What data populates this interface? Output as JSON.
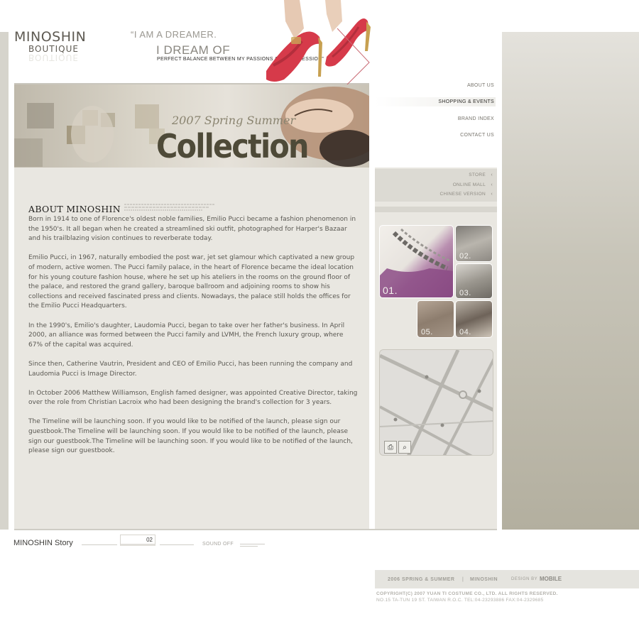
{
  "brand": {
    "logo_main": "MINOSHIN",
    "logo_sub": "BOUTIQUE"
  },
  "tagline": {
    "line1": "“I AM A DREAMER.",
    "line2": "I DREAM OF",
    "line3": "PERFECT BALANCE BETWEEN MY PASSIONS AND PROFESSION”"
  },
  "banner": {
    "season": "2007 Spring Summer",
    "title": "Collection"
  },
  "nav": {
    "items": [
      {
        "label": "ABOUT US"
      },
      {
        "label": "SHOPPING & EVENTS"
      },
      {
        "label": "BRAND INDEX"
      },
      {
        "label": "CONTACT US"
      }
    ],
    "active": "SHOPPING & EVENTS"
  },
  "subnav": {
    "items": [
      {
        "label": "STORE"
      },
      {
        "label": "ONLINE MALL"
      },
      {
        "label": "CHINESE VERSION"
      }
    ]
  },
  "article": {
    "heading": "ABOUT MINOSHIN",
    "paragraphs": [
      "Born in 1914 to one of Florence's oldest noble families, Emilio Pucci became a fashion phenomenon in the 1950's. It all began when he created a streamlined ski outfit, photographed for Harper's Bazaar and his trailblazing vision continues to reverberate today.",
      "Emilio Pucci, in 1967, naturally embodied the post war, jet set glamour which captivated a new group of modern, active women. The Pucci family palace, in the heart of Florence became the ideal location for his young couture fashion house, where he set up his ateliers in the rooms on the ground floor of the palace, and restored the grand gallery, baroque ballroom and adjoining rooms to show his collections and received fascinated press and clients. Nowadays, the palace still holds the offices for the Emilio Pucci Headquarters.",
      "In the 1990's, Emilio's daughter, Laudomia Pucci, began to take over her father's business. In April 2000, an alliance was formed between the Pucci family and LVMH, the French luxury group, where 67% of the capital was acquired.",
      "Since then, Catherine Vautrin, President and CEO of Emilio Pucci, has been running the company and Laudomia Pucci is Image Director.",
      "In October 2006 Matthew Williamson, English famed designer, was appointed Creative Director, taking over the role from Christian Lacroix who had been designing the brand's collection for 3 years.",
      "The Timeline will be launching soon. If you would like to be notified of the launch, please sign our guestbook.The Timeline will be launching soon. If you would like to be notified of the launch, please sign our guestbook.The Timeline will be launching soon. If you would like to be notified of the launch, please sign our guestbook."
    ]
  },
  "gallery": {
    "thumbs": [
      {
        "num": "01."
      },
      {
        "num": "02."
      },
      {
        "num": "03."
      },
      {
        "num": "04."
      },
      {
        "num": "05."
      }
    ]
  },
  "map": {
    "print_icon": "printer-icon",
    "zoom_icon": "magnifier-icon"
  },
  "story": {
    "title": "MINOSHIN Story",
    "page": "02",
    "sound": "SOUND OFF"
  },
  "footer": {
    "season": "2006  SPRING & SUMMER",
    "separator": "|",
    "brand": "MINOSHIN",
    "design_by": "DESIGN BY",
    "maker": "MOBILE",
    "copyright": "COPYRIGHT(C) 2007  YUAN TI COSTUME CO., LTD.   ALL RIGHTS RESERVED.",
    "address": "NO.15 TA-TUN 19 ST. TAIWAN R.O.C.    TEL:04-23293886     FAX:04-2329685"
  },
  "colors": {
    "page_bg": "#ffffff",
    "content_bg": "#e9e7e1",
    "right_panel": "#b3af9f",
    "accent_red": "#d63a4a",
    "text": "#5a5852"
  }
}
